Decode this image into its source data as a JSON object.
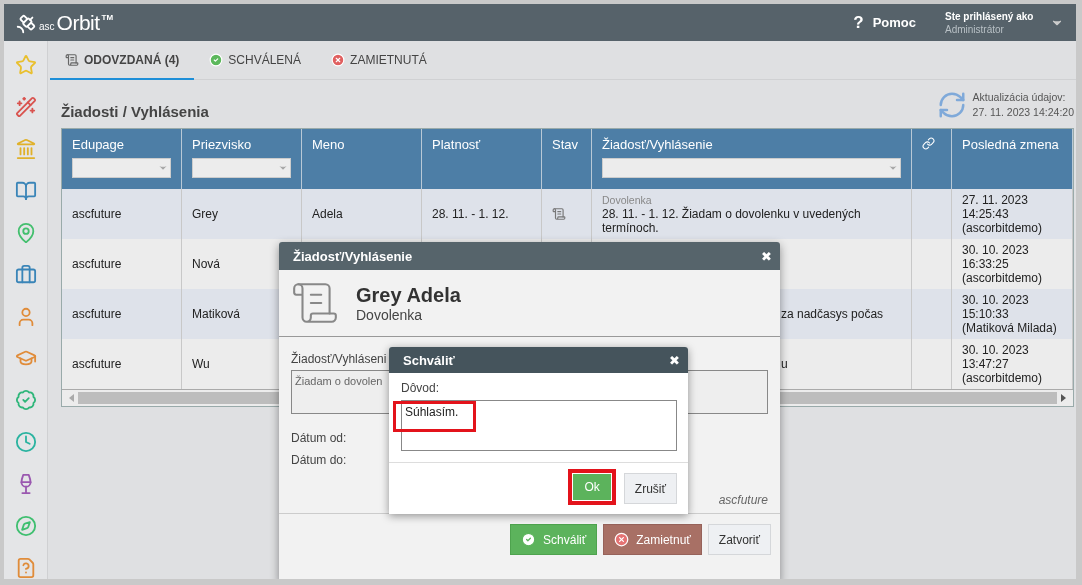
{
  "header": {
    "logo": {
      "prefix": "asc",
      "name": "Orbit",
      "mark": "TM"
    },
    "help": {
      "icon": "?",
      "label": "Pomoc"
    },
    "user": {
      "caption": "Ste prihlásený ako",
      "name": "Administrátor"
    }
  },
  "tabs": [
    {
      "label": "ODOVZDANÁ (4)",
      "kind": "submitted",
      "selected": true
    },
    {
      "label": "SCHVÁLENÁ",
      "kind": "approved",
      "selected": false
    },
    {
      "label": "ZAMIETNUTÁ",
      "kind": "rejected",
      "selected": false
    }
  ],
  "page_title": "Žiadosti / Vyhlásenia",
  "refresh": {
    "label": "Aktualizácia údajov:",
    "time": "27. 11. 2023 14:24:20"
  },
  "table": {
    "columns": [
      {
        "label": "Edupage",
        "filter": true
      },
      {
        "label": "Priezvisko",
        "filter": true
      },
      {
        "label": "Meno",
        "filter": false
      },
      {
        "label": "Platnosť",
        "filter": false
      },
      {
        "label": "Stav",
        "filter": false
      },
      {
        "label": "Žiadosť/Vyhlásenie",
        "filter": true
      },
      {
        "kind": "link",
        "filter": false
      },
      {
        "label": "Posledná zmena",
        "filter": false
      }
    ],
    "rows": [
      {
        "edupage": "ascfuture",
        "surname": "Grey",
        "name": "Adela",
        "validity": "28. 11. - 1. 12.",
        "kind": "submitted",
        "request_type": "Dovolenka",
        "request": "28. 11. - 1. 12. Žiadam o dovolenku v uvedených termínoch.",
        "changed": "27. 11. 2023\n14:25:43\n(ascorbitdemo)"
      },
      {
        "edupage": "ascfuture",
        "surname": "Nová",
        "changed": "30. 10. 2023\n16:33:25\n(ascorbitdemo)"
      },
      {
        "edupage": "ascfuture",
        "surname": "Matiková",
        "request_tail": "za nadčasys počas",
        "changed": "30. 10. 2023\n15:10:33\n(Matiková Milada)"
      },
      {
        "edupage": "ascfuture",
        "surname": "Wu",
        "request_tail": "u",
        "changed": "30. 10. 2023\n13:47:27\n(ascorbitdemo)"
      }
    ]
  },
  "request_dialog": {
    "title": "Žiadosť/Vyhlásenie",
    "close": "✖",
    "person": "Grey Adela",
    "type": "Dovolenka",
    "request_label": "Žiadosť/Vyhláseni",
    "request_text": "Žiadam o dovolen",
    "date_from_label": "Dátum od:",
    "date_to_label": "Dátum do:",
    "school": "ascfuture",
    "buttons": [
      {
        "label": "Schváliť",
        "kind": "approve"
      },
      {
        "label": "Zamietnuť",
        "kind": "reject"
      },
      {
        "label": "Zatvoriť",
        "kind": "plain"
      }
    ]
  },
  "approve_dialog": {
    "title": "Schváliť",
    "close": "✖",
    "reason_label": "Dôvod:",
    "reason": "Súhlasím.",
    "reason_highlighted": true,
    "buttons": [
      {
        "label": "Ok",
        "kind": "ok",
        "highlighted": true
      },
      {
        "label": "Zrušiť",
        "kind": "plain",
        "highlighted": false
      }
    ]
  }
}
